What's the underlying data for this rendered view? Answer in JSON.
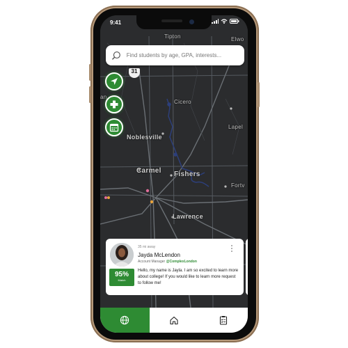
{
  "status": {
    "time": "9:41"
  },
  "search": {
    "placeholder": "Find students by age, GPA, interests..."
  },
  "map": {
    "labels": {
      "tipton": "Tipton",
      "elwood": "Elwo",
      "cicero": "Cicero",
      "noblesville": "Noblesville",
      "lapel": "Lapel",
      "carmel": "Carmel",
      "fishers": "Fishers",
      "fortville": "Fortv",
      "lawrence": "Lawrence",
      "highway": "31",
      "partial": "e",
      "partial2": "an"
    }
  },
  "card": {
    "time": "35 mi away",
    "name": "Jayda McLendon",
    "role": "Account Manager",
    "handle": "@ComplexLondon",
    "message": "Hello, my name is Jayla. I am so excited to learn more about college! If you would like to learn more request to follow me!",
    "match_pct": "95%",
    "match_label": "Match"
  },
  "tabs": [
    {
      "name": "globe-icon",
      "active": true
    },
    {
      "name": "home-icon",
      "active": false
    },
    {
      "name": "clipboard-icon",
      "active": false
    }
  ],
  "colors": {
    "accent": "#2e8b33",
    "map_bg": "#2b2c2e",
    "water": "#2d3f7a"
  }
}
